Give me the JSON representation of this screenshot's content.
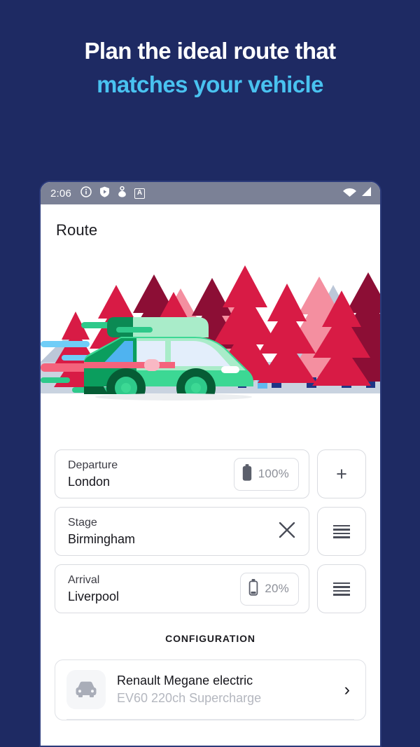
{
  "promo": {
    "line1": "Plan the ideal route that",
    "line2": "matches your vehicle",
    "bg_color": "#1e2a63",
    "line1_color": "#ffffff",
    "line2_color": "#49c2f0"
  },
  "status_bar": {
    "time": "2:06",
    "icons_left": [
      "info-icon",
      "shield-play-icon",
      "location-share-icon",
      "a-badge-icon"
    ],
    "badge_letter": "A",
    "icons_right": [
      "wifi-icon",
      "cellular-signal-icon"
    ]
  },
  "app": {
    "title": "Route"
  },
  "illustration": {
    "name": "green-station-wagon-forest-illustration",
    "colors": {
      "car_body": "#3cd894",
      "car_body_dark": "#0b8a54",
      "car_window": "#e3eefb",
      "car_window_blue": "#4fb3f0",
      "wheel": "#065c35",
      "tree_crimson": "#d81b45",
      "tree_maroon": "#8c0e35",
      "tree_pink": "#f48fa0",
      "mountain": "#bcc7d8",
      "ground": "#c9d3e0",
      "trunk": "#1f3585"
    }
  },
  "route": {
    "rows": [
      {
        "label": "Departure",
        "value": "London",
        "battery_pct": "100%",
        "battery_level": 100,
        "side_button": "add-stage-button",
        "side_icon": "plus-icon"
      },
      {
        "label": "Stage",
        "value": "Birmingham",
        "clear_icon": "close-icon",
        "side_button": "reorder-handle-button",
        "side_icon": "drag-handle-icon"
      },
      {
        "label": "Arrival",
        "value": "Liverpool",
        "battery_pct": "20%",
        "battery_level": 20,
        "side_button": "reorder-handle-button",
        "side_icon": "drag-handle-icon"
      }
    ]
  },
  "configuration": {
    "section_title": "CONFIGURATION",
    "vehicle": {
      "icon": "car-front-icon",
      "name": "Renault Megane electric",
      "subtitle": "EV60 220ch Supercharge",
      "chevron": "›"
    }
  }
}
